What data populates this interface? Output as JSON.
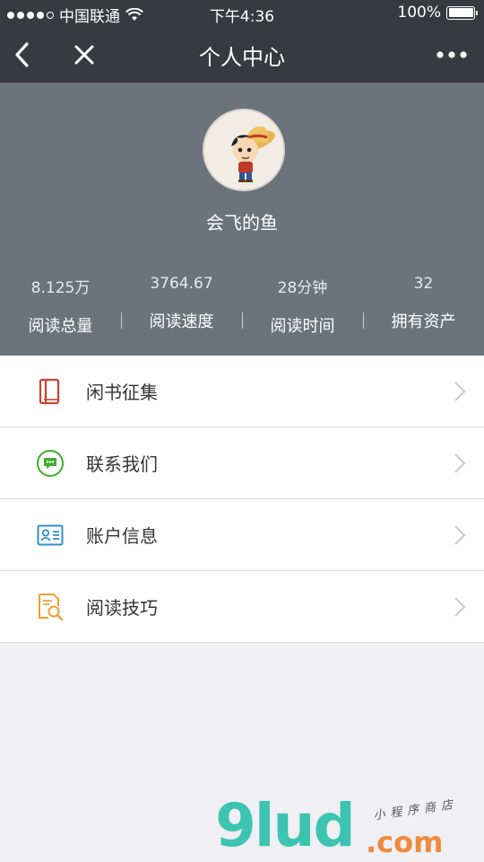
{
  "status": {
    "carrier": "中国联通",
    "time": "下午4:36",
    "battery": "100%",
    "battery_level": 1.0
  },
  "nav": {
    "title": "个人中心"
  },
  "profile": {
    "username": "会飞的鱼",
    "stats": [
      {
        "value": "8.125万",
        "label": "阅读总量"
      },
      {
        "value": "3764.67",
        "label": "阅读速度"
      },
      {
        "value": "28分钟",
        "label": "阅读时间"
      },
      {
        "value": "32",
        "label": "拥有资产"
      }
    ]
  },
  "menu": [
    {
      "label": "闲书征集",
      "icon": "book-icon",
      "color": "#d0402f"
    },
    {
      "label": "联系我们",
      "icon": "chat-icon",
      "color": "#3fae2a"
    },
    {
      "label": "账户信息",
      "icon": "id-card-icon",
      "color": "#2f8fd0"
    },
    {
      "label": "阅读技巧",
      "icon": "document-search-icon",
      "color": "#f0a030"
    }
  ],
  "watermark": {
    "brand": "9lud",
    "domain": ".com",
    "tagline": "小程序商店"
  }
}
